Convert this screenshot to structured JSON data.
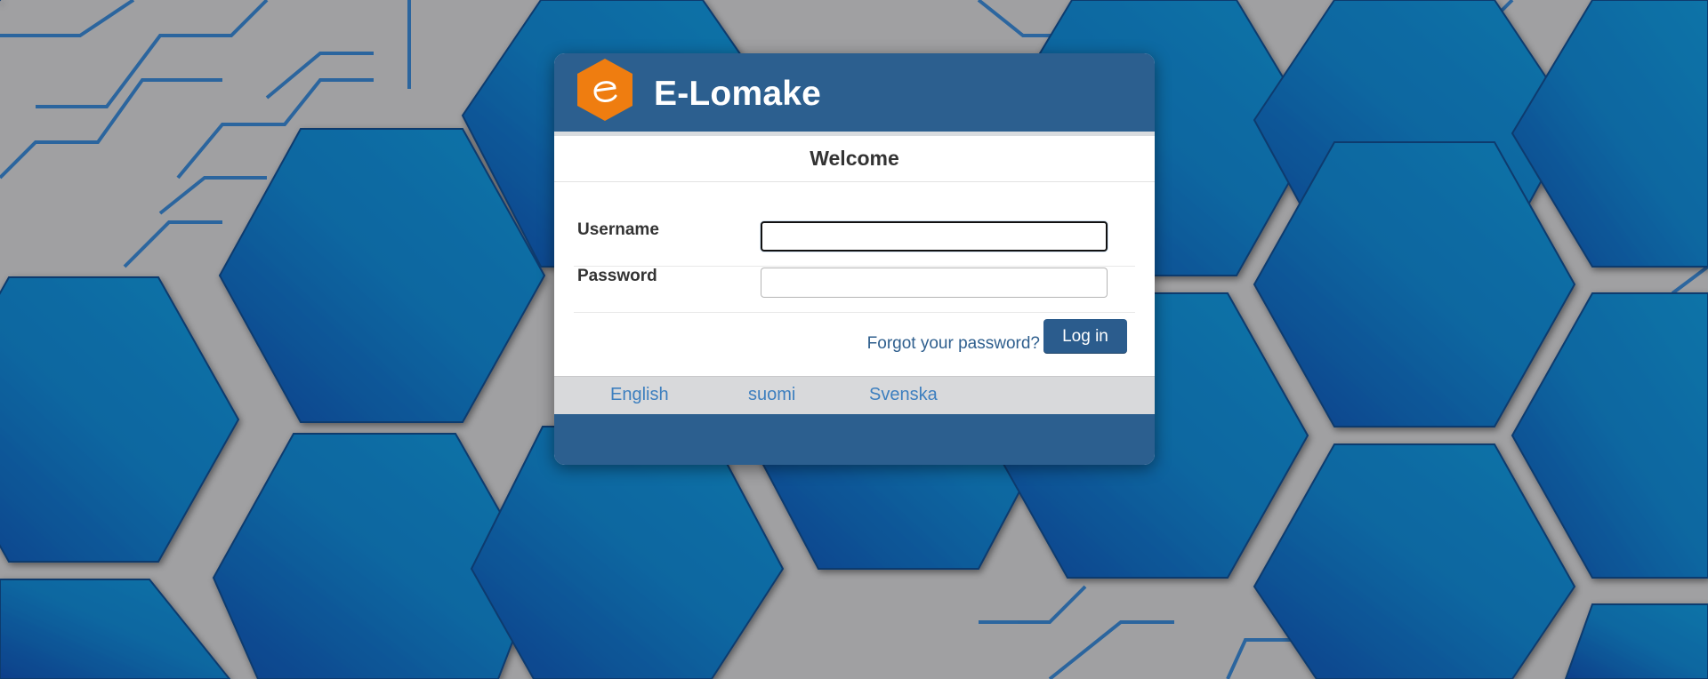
{
  "app": {
    "title": "E-Lomake",
    "logo_icon": "hexagon-e-logo-icon"
  },
  "colors": {
    "brand_blue": "#2c5f8f",
    "logo_orange": "#ef7d10",
    "link_blue": "#3d7fbf"
  },
  "login": {
    "heading": "Welcome",
    "username_label": "Username",
    "username_value": "",
    "password_label": "Password",
    "password_value": "",
    "forgot_link": "Forgot your password?",
    "submit_label": "Log in"
  },
  "languages": [
    "English",
    "suomi",
    "Svenska"
  ]
}
